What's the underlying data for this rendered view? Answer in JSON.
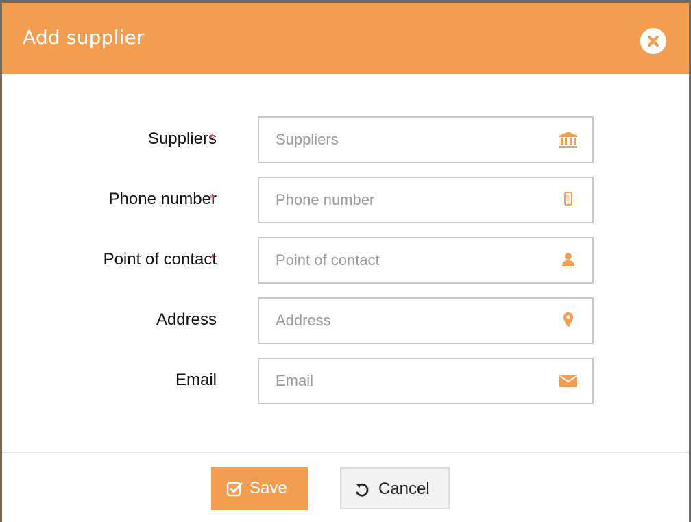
{
  "modal": {
    "title": "Add supplier",
    "close_icon": "close-circle-icon"
  },
  "form": {
    "fields": [
      {
        "label": "Suppliers",
        "required": true,
        "required_mark": "*",
        "placeholder": "Suppliers",
        "value": "",
        "icon": "bank-icon"
      },
      {
        "label": "Phone number",
        "required": true,
        "required_mark": "*",
        "placeholder": "Phone number",
        "value": "",
        "icon": "mobile-phone-icon"
      },
      {
        "label": "Point of contact",
        "required": true,
        "required_mark": "*",
        "placeholder": "Point of contact",
        "value": "",
        "icon": "user-icon"
      },
      {
        "label": "Address",
        "required": false,
        "placeholder": "Address",
        "value": "",
        "icon": "map-marker-icon"
      },
      {
        "label": "Email",
        "required": false,
        "placeholder": "Email",
        "value": "",
        "icon": "envelope-icon"
      }
    ]
  },
  "footer": {
    "save_label": "Save",
    "save_icon": "check-square-icon",
    "cancel_label": "Cancel",
    "cancel_icon": "undo-icon"
  },
  "colors": {
    "accent": "#f29d4f",
    "required": "#d9534f",
    "border": "#c8c8c8",
    "placeholder": "#9a9a9a"
  }
}
